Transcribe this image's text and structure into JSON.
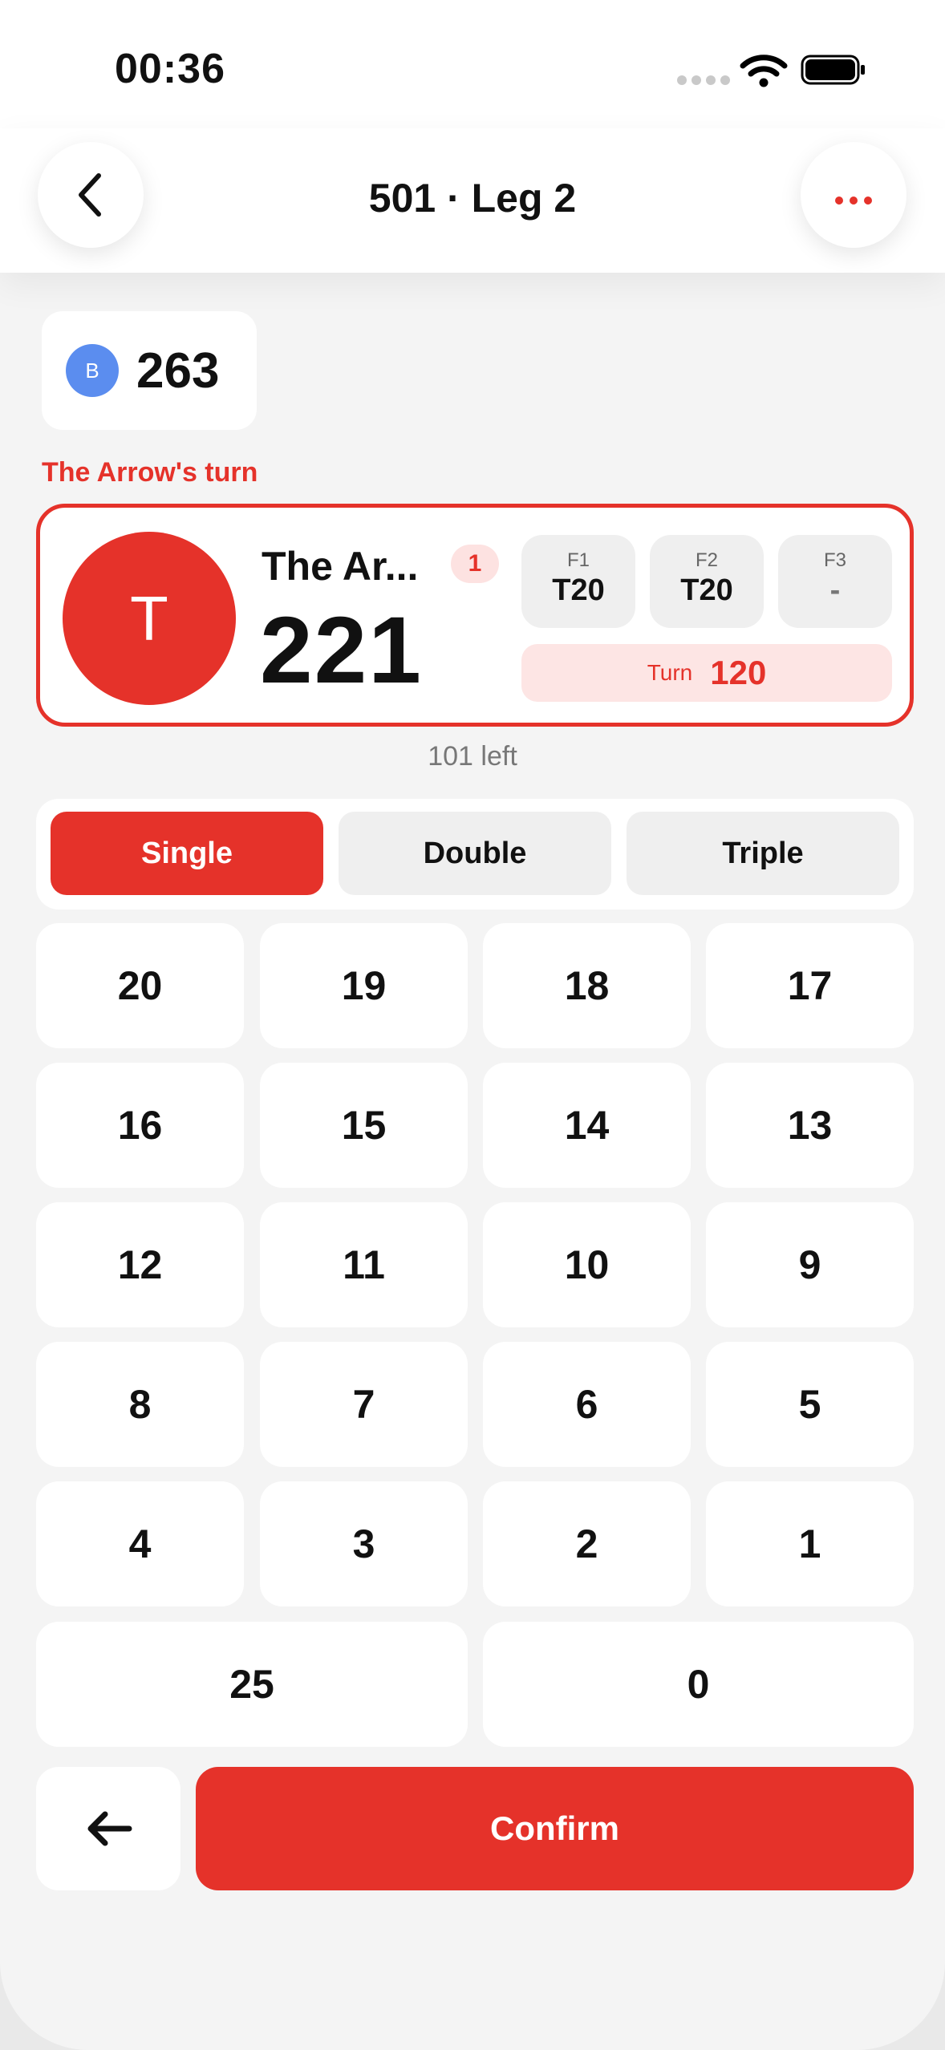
{
  "status_bar": {
    "time": "00:36"
  },
  "header": {
    "title": "501 · Leg 2"
  },
  "opponent": {
    "initial": "B",
    "score": "263"
  },
  "turn_label": "The Arrow's turn",
  "current_player": {
    "initial": "T",
    "name": "The Ar...",
    "badge": "1",
    "score": "221",
    "darts": [
      {
        "label": "F1",
        "value": "T20"
      },
      {
        "label": "F2",
        "value": "T20"
      },
      {
        "label": "F3",
        "value": "-"
      }
    ],
    "turn_label": "Turn",
    "turn_total": "120"
  },
  "remaining": "101 left",
  "multiplier": {
    "options": [
      "Single",
      "Double",
      "Triple"
    ],
    "selected": "Single"
  },
  "keypad": {
    "rows": [
      [
        "20",
        "19",
        "18",
        "17"
      ],
      [
        "16",
        "15",
        "14",
        "13"
      ],
      [
        "12",
        "11",
        "10",
        "9"
      ],
      [
        "8",
        "7",
        "6",
        "5"
      ],
      [
        "4",
        "3",
        "2",
        "1"
      ]
    ],
    "bottom": [
      "25",
      "0"
    ]
  },
  "actions": {
    "confirm": "Confirm"
  },
  "icons": {
    "back": "chevron-left-icon",
    "more": "more-horizontal-icon",
    "undo": "arrow-left-icon"
  },
  "colors": {
    "accent": "#e5322a",
    "opponent": "#5b8def",
    "background": "#f4f4f4"
  }
}
